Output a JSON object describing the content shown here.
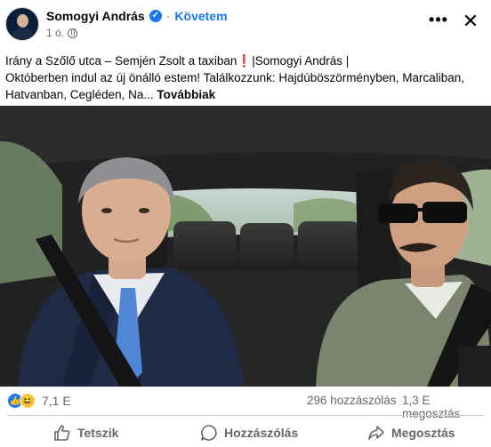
{
  "post": {
    "author": "Somogyi András",
    "verified_mark": "✓",
    "follow_label": "Követem",
    "time": "1 ó.",
    "separator": "·",
    "text_line1_a": "Irány a Szőlő utca – Semjén Zsolt a taxiban",
    "text_line1_warn": "❗",
    "text_line1_b": "|Somogyi András |",
    "text_line2": "Októberben indul az új önálló estem! Találkozzunk: Hajdúböszörményben, Marcaliban,",
    "text_line3": "Hatvanban, Cegléden, Na...",
    "see_more": "Továbbiak",
    "more_icon": "•••",
    "close_icon": "✕"
  },
  "stats": {
    "reaction_count": "7,1 E",
    "comments": "296 hozzászólás",
    "shares": "1,3 E megosztás",
    "like_icon": "👍",
    "haha_icon": "😆"
  },
  "actions": {
    "like": "Tetszik",
    "comment": "Hozzászólás",
    "share": "Megosztás"
  },
  "colors": {
    "accent": "#1877f2",
    "muted": "#65676b",
    "warn": "#e41e3f"
  }
}
